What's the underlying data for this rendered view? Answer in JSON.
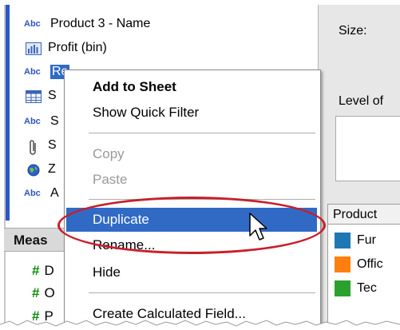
{
  "dimensions": [
    {
      "type": "Abc",
      "label": "Product 3 - Name"
    },
    {
      "type": "bin",
      "label": "Profit (bin)"
    },
    {
      "type": "Abc",
      "label": "Re"
    },
    {
      "type": "table",
      "label": "S"
    },
    {
      "type": "Abc",
      "label": "S"
    },
    {
      "type": "paperclip",
      "label": "S"
    },
    {
      "type": "globe",
      "label": "Z"
    },
    {
      "type": "Abc",
      "label": "A"
    }
  ],
  "measures": {
    "header": "Meas",
    "items": [
      "D",
      "O",
      "P"
    ]
  },
  "right_panel": {
    "size_label": "Size:",
    "level_label": "Level of",
    "product_header": "Product",
    "legend": [
      {
        "label": "Fur",
        "color": "#1f77b4"
      },
      {
        "label": "Offic",
        "color": "#ff7f0e"
      },
      {
        "label": "Tec",
        "color": "#2ca02c"
      }
    ]
  },
  "context_menu": {
    "add_to_sheet": "Add to Sheet",
    "show_quick_filter": "Show Quick Filter",
    "copy": "Copy",
    "paste": "Paste",
    "duplicate": "Duplicate",
    "rename": "Rename...",
    "hide": "Hide",
    "create_calculated_field": "Create Calculated Field..."
  },
  "colors": {
    "highlight": "#316ac5",
    "annotation_ring": "#c81e2a",
    "dimension_accent": "#2d55c2",
    "measure_accent": "#0a8a0a"
  }
}
